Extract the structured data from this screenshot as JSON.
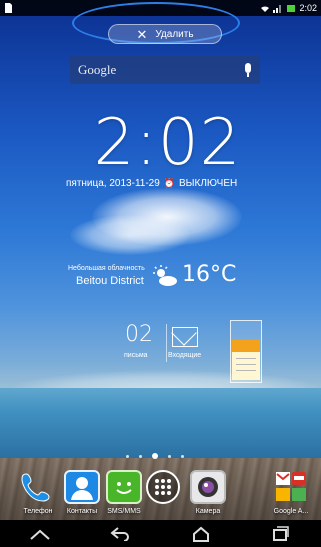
{
  "status_bar": {
    "time": "2:02"
  },
  "drop_target": {
    "label": "Удалить"
  },
  "search": {
    "label": "Google"
  },
  "clock": {
    "time": "2:02",
    "date": "пятница, 2013-11-29",
    "alarm": "ВЫКЛЮЧЕН"
  },
  "weather": {
    "condition": "Небольшая облачность",
    "location": "Beitou District",
    "temperature": "16°C"
  },
  "mail": {
    "count": "02",
    "label_left": "письма",
    "label_right": "Входящие"
  },
  "page_indicator": {
    "pages": 5,
    "active_index": 2
  },
  "dock": [
    {
      "label": "Телефон",
      "icon": "phone-icon"
    },
    {
      "label": "Контакты",
      "icon": "contacts-icon"
    },
    {
      "label": "SMS/MMS",
      "icon": "sms-icon"
    },
    {
      "label": "",
      "icon": "all-apps-icon"
    },
    {
      "label": "Камера",
      "icon": "camera-icon"
    },
    {
      "label": "Google A...",
      "icon": "google-apps-icon"
    }
  ],
  "navbar": {
    "back": "back-icon",
    "home": "home-icon",
    "recents": "recent-apps-icon",
    "menu": "chevron-up-icon"
  },
  "colors": {
    "highlight_oval": "#2d7ee8",
    "memo_accent": "#f2a21b"
  }
}
